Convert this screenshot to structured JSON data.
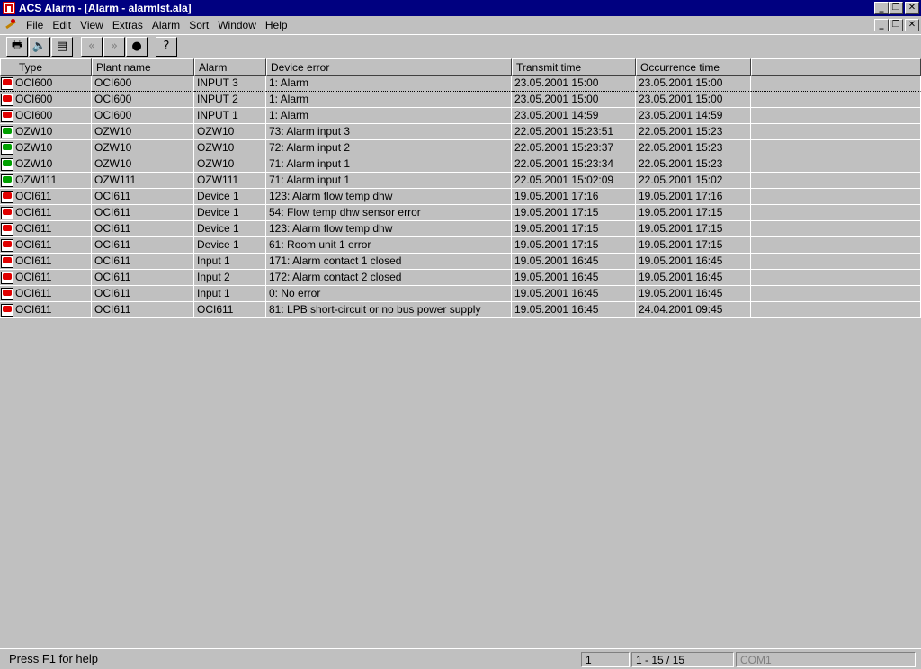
{
  "window": {
    "title": "ACS Alarm - [Alarm - alarmlst.ala]",
    "buttons": [
      "_",
      "❐",
      "✕"
    ]
  },
  "menu": {
    "items": [
      "File",
      "Edit",
      "View",
      "Extras",
      "Alarm",
      "Sort",
      "Window",
      "Help"
    ]
  },
  "toolbar": {
    "print_icon": "🖶",
    "mute_icon": "🔈",
    "properties_icon": "▤",
    "prev_icon": "«",
    "next_icon": "»",
    "record_icon": "●",
    "help_icon": "?"
  },
  "table": {
    "columns": [
      "Type",
      "Plant name",
      "Alarm",
      "Device error",
      "Transmit time",
      "Occurrence time"
    ],
    "rows": [
      {
        "status": "red",
        "type": "OCI600",
        "plant": "OCI600",
        "alarm": "INPUT 3",
        "error": "1: Alarm",
        "transmit": "23.05.2001 15:00",
        "occurrence": "23.05.2001 15:00"
      },
      {
        "status": "red",
        "type": "OCI600",
        "plant": "OCI600",
        "alarm": "INPUT 2",
        "error": "1: Alarm",
        "transmit": "23.05.2001 15:00",
        "occurrence": "23.05.2001 15:00"
      },
      {
        "status": "red",
        "type": "OCI600",
        "plant": "OCI600",
        "alarm": "INPUT 1",
        "error": "1: Alarm",
        "transmit": "23.05.2001 14:59",
        "occurrence": "23.05.2001 14:59"
      },
      {
        "status": "green",
        "type": "OZW10",
        "plant": "OZW10",
        "alarm": "OZW10",
        "error": "73: Alarm input 3",
        "transmit": "22.05.2001 15:23:51",
        "occurrence": "22.05.2001 15:23"
      },
      {
        "status": "green",
        "type": "OZW10",
        "plant": "OZW10",
        "alarm": "OZW10",
        "error": "72: Alarm input 2",
        "transmit": "22.05.2001 15:23:37",
        "occurrence": "22.05.2001 15:23"
      },
      {
        "status": "green",
        "type": "OZW10",
        "plant": "OZW10",
        "alarm": "OZW10",
        "error": "71: Alarm input 1",
        "transmit": "22.05.2001 15:23:34",
        "occurrence": "22.05.2001 15:23"
      },
      {
        "status": "green",
        "type": "OZW111",
        "plant": "OZW111",
        "alarm": "OZW111",
        "error": "71: Alarm input 1",
        "transmit": "22.05.2001 15:02:09",
        "occurrence": "22.05.2001 15:02"
      },
      {
        "status": "red",
        "type": "OCI611",
        "plant": "OCI611",
        "alarm": "Device 1",
        "error": "123: Alarm flow temp dhw",
        "transmit": "19.05.2001 17:16",
        "occurrence": "19.05.2001 17:16"
      },
      {
        "status": "red",
        "type": "OCI611",
        "plant": "OCI611",
        "alarm": "Device 1",
        "error": "54: Flow temp dhw sensor error",
        "transmit": "19.05.2001 17:15",
        "occurrence": "19.05.2001 17:15"
      },
      {
        "status": "red",
        "type": "OCI611",
        "plant": "OCI611",
        "alarm": "Device 1",
        "error": "123: Alarm flow temp dhw",
        "transmit": "19.05.2001 17:15",
        "occurrence": "19.05.2001 17:15"
      },
      {
        "status": "red",
        "type": "OCI611",
        "plant": "OCI611",
        "alarm": "Device 1",
        "error": "61: Room unit 1 error",
        "transmit": "19.05.2001 17:15",
        "occurrence": "19.05.2001 17:15"
      },
      {
        "status": "red",
        "type": "OCI611",
        "plant": "OCI611",
        "alarm": "Input 1",
        "error": "171: Alarm contact 1 closed",
        "transmit": "19.05.2001 16:45",
        "occurrence": "19.05.2001 16:45"
      },
      {
        "status": "red",
        "type": "OCI611",
        "plant": "OCI611",
        "alarm": "Input 2",
        "error": "172: Alarm contact 2 closed",
        "transmit": "19.05.2001 16:45",
        "occurrence": "19.05.2001 16:45"
      },
      {
        "status": "red",
        "type": "OCI611",
        "plant": "OCI611",
        "alarm": "Input 1",
        "error": "0: No error",
        "transmit": "19.05.2001 16:45",
        "occurrence": "19.05.2001 16:45"
      },
      {
        "status": "red",
        "type": "OCI611",
        "plant": "OCI611",
        "alarm": "OCI611",
        "error": "81: LPB short-circuit or no bus power supply",
        "transmit": "19.05.2001 16:45",
        "occurrence": "24.04.2001 09:45"
      }
    ]
  },
  "statusbar": {
    "help": "Press F1 for help",
    "pane1": "1",
    "pane2": "1 - 15 / 15",
    "pane3": "COM1"
  },
  "colors": {
    "titlebar": "#000080",
    "face": "#c0c0c0",
    "alarm_red": "#e00000",
    "ok_green": "#00a000"
  }
}
